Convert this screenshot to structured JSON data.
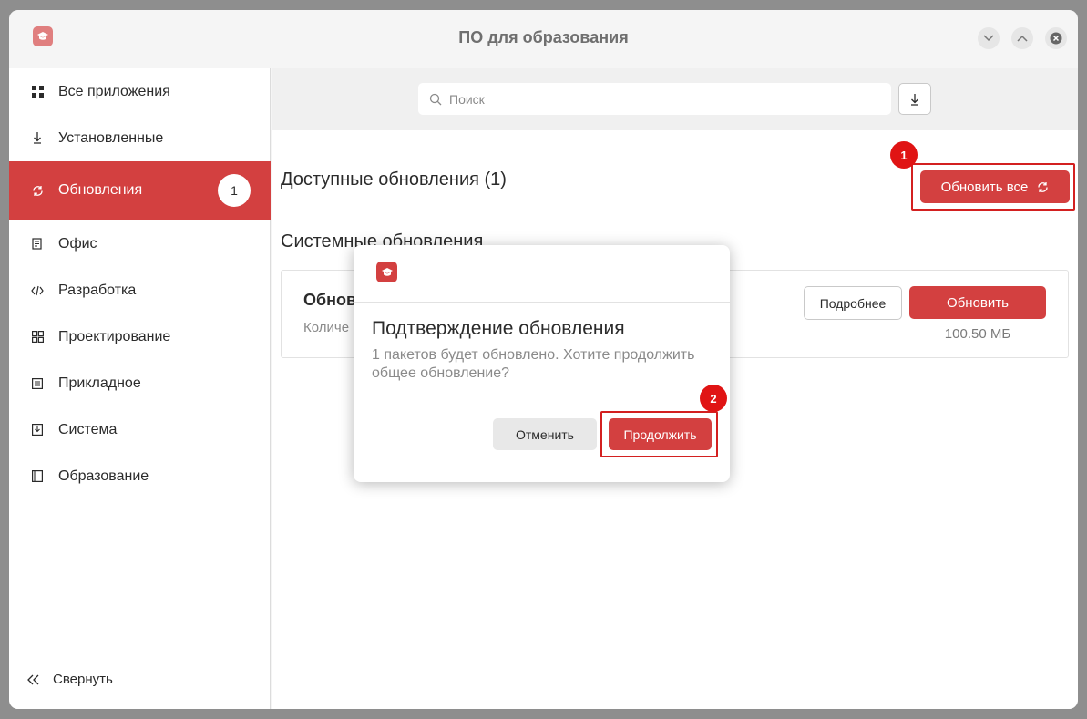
{
  "window": {
    "title": "ПО для образования"
  },
  "sidebar": {
    "items": [
      {
        "label": "Все приложения",
        "icon": "grid-icon"
      },
      {
        "label": "Установленные",
        "icon": "download-icon"
      },
      {
        "label": "Обновления",
        "icon": "refresh-icon",
        "badge": "1"
      },
      {
        "label": "Офис",
        "icon": "office-icon"
      },
      {
        "label": "Разработка",
        "icon": "code-icon"
      },
      {
        "label": "Проектирование",
        "icon": "design-icon"
      },
      {
        "label": "Прикладное",
        "icon": "list-icon"
      },
      {
        "label": "Система",
        "icon": "system-icon"
      },
      {
        "label": "Образование",
        "icon": "book-icon"
      }
    ],
    "collapse_label": "Свернуть"
  },
  "search": {
    "placeholder": "Поиск"
  },
  "main": {
    "available_title": "Доступные обновления (1)",
    "update_all_label": "Обновить все",
    "system_title": "Системные обновления",
    "card": {
      "title": "Обнов",
      "subtitle": "Количе",
      "details_label": "Подробнее",
      "update_label": "Обновить",
      "size": "100.50 МБ"
    }
  },
  "dialog": {
    "title": "Подтверждение обновления",
    "message": "1 пакетов будет обновлено. Хотите продолжить общее обновление?",
    "cancel_label": "Отменить",
    "continue_label": "Продолжить"
  },
  "markers": {
    "one": "1",
    "two": "2"
  },
  "colors": {
    "accent": "#d34040",
    "marker": "#e01414"
  }
}
